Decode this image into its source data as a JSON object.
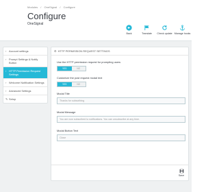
{
  "breadcrumb": [
    "Modules",
    "/",
    "OneSignal",
    "/",
    "Configure"
  ],
  "page": {
    "title": "Configure",
    "subtitle": "OneSignal"
  },
  "toolbar": {
    "back": "Back",
    "translate": "Translate",
    "check_update": "Check update",
    "manage_hooks": "Manage hooks"
  },
  "sidebar": {
    "items": [
      {
        "label": "Account settings"
      },
      {
        "label": "Prompt Settings & Notify Button"
      },
      {
        "label": "HTTP Permission Request Settings"
      },
      {
        "label": "Welcome Notification Settings"
      },
      {
        "label": "Advanced Settings"
      },
      {
        "label": "Setup"
      }
    ]
  },
  "panel": {
    "title": "HTTP PERMISSION REQUEST SETTINGS",
    "use_http_label": "Use the HTTP permission request for prompting users",
    "customize_label": "Customize the post request modal text",
    "yes": "YES",
    "no": "NO",
    "modal_title_label": "Modal Title",
    "modal_title_value": "Thanks for subscribing",
    "modal_message_label": "Modal Message",
    "modal_message_value": "You are now subscribed to notifications. You can unsubscribe at any time.",
    "modal_button_label": "Modal Button Text",
    "modal_button_value": "Close",
    "save": "Save"
  },
  "colors": {
    "accent": "#25b9d7",
    "background": "#eff1f2"
  }
}
